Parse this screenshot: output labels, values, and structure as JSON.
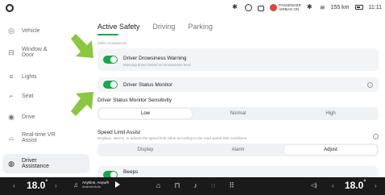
{
  "status_bar": {
    "airbag_label_1": "PASSENGER",
    "airbag_label_2": "AIRBAG ON",
    "range": "155 km",
    "time": "11:11"
  },
  "sidebar": {
    "items": [
      {
        "label": "Vehicle",
        "icon": "steering-wheel-icon"
      },
      {
        "label": "Window &\nDoor",
        "icon": "window-icon"
      },
      {
        "label": "Lights",
        "icon": "headlight-icon"
      },
      {
        "label": "Seat",
        "icon": "seat-icon"
      },
      {
        "label": "Drive",
        "icon": "steering-wheel-icon"
      },
      {
        "label": "Real-time VR\nAssist",
        "icon": "car-view-icon"
      },
      {
        "label": "Driver\nAssistance",
        "icon": "driver-assist-icon"
      }
    ],
    "active_index": 6
  },
  "tabs": [
    "Active Safety",
    "Driving",
    "Parking"
  ],
  "active_tab": 0,
  "section_label": "Other Assistances",
  "drowsiness": {
    "title": "Driver Drowsiness Warning",
    "subtitle": "Warning driver based on Drowsiness level",
    "enabled": true
  },
  "status_monitor": {
    "title": "Driver Status Monitor",
    "enabled": true
  },
  "sensitivity": {
    "title": "Driver Status Monitor Sensitivity",
    "options": [
      "Low",
      "Normal",
      "High"
    ],
    "selected_index": 0
  },
  "speed_limit": {
    "title": "Speed Limit Assist",
    "subtitle": "Displays, alarms, or adjusts the speed limit value according to the road speed limit conditions",
    "options": [
      "Display",
      "Alarm",
      "Adjust"
    ],
    "selected_index": 2
  },
  "beeps": {
    "title": "Beeps",
    "enabled": true
  },
  "dock": {
    "left_temp": "18.0",
    "right_temp": "18.0",
    "temp_unit": "°",
    "song_title": "Anytime, Anyw/h",
    "song_artist": "Android Auto"
  },
  "colors": {
    "accent": "#19a74a",
    "arrow": "#8dc63f",
    "dock_bg": "#1a1a1a"
  }
}
